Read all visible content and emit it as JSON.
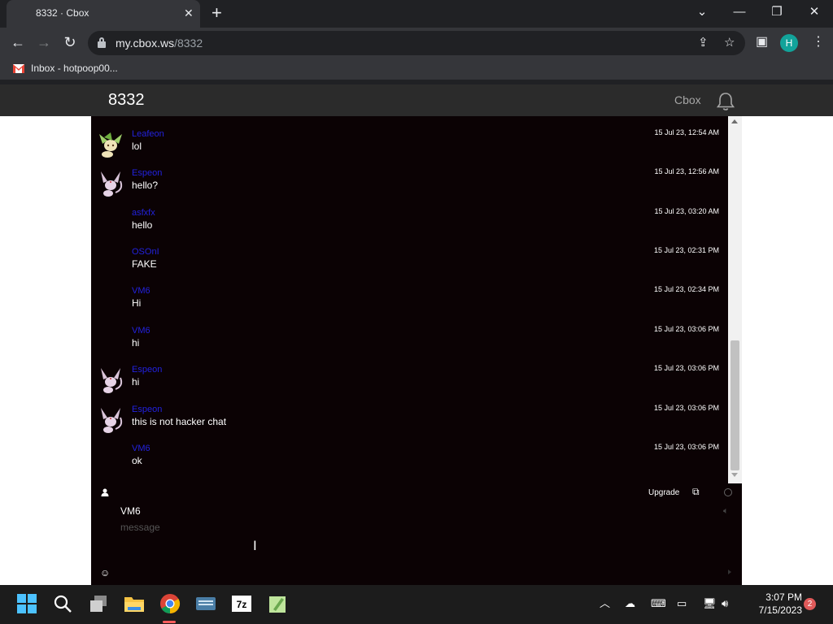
{
  "browser": {
    "tab_title": "8332 · Cbox",
    "tab_close": "✕",
    "new_tab": "+",
    "url_host": "my.cbox.ws",
    "url_path": "/8332",
    "bookmark_label": "Inbox - hotpoop00...",
    "avatar_letter": "H"
  },
  "site": {
    "title": "8332",
    "brand": "Cbox"
  },
  "messages": [
    {
      "name": "Leafeon",
      "text": "lol",
      "time": "15 Jul 23, 12:54 AM",
      "avatar": "leafeon-avatar"
    },
    {
      "name": "Espeon",
      "text": "hello?",
      "time": "15 Jul 23, 12:56 AM",
      "avatar": "espeon-avatar"
    },
    {
      "name": "asfxfx",
      "text": "hello",
      "time": "15 Jul 23, 03:20 AM",
      "avatar": ""
    },
    {
      "name": "OSOnI",
      "text": "FAKE",
      "time": "15 Jul 23, 02:31 PM",
      "avatar": ""
    },
    {
      "name": "VM6",
      "text": "Hi",
      "time": "15 Jul 23, 02:34 PM",
      "avatar": ""
    },
    {
      "name": "VM6",
      "text": "hi",
      "time": "15 Jul 23, 03:06 PM",
      "avatar": ""
    },
    {
      "name": "Espeon",
      "text": "hi",
      "time": "15 Jul 23, 03:06 PM",
      "avatar": "espeon-avatar"
    },
    {
      "name": "Espeon",
      "text": "this is not hacker chat",
      "time": "15 Jul 23, 03:06 PM",
      "avatar": "espeon-avatar"
    },
    {
      "name": "VM6",
      "text": "ok",
      "time": "15 Jul 23, 03:06 PM",
      "avatar": ""
    }
  ],
  "form": {
    "upgrade_label": "Upgrade",
    "name_value": "VM6",
    "message_placeholder": "message"
  },
  "taskbar": {
    "time": "3:07 PM",
    "date": "7/15/2023",
    "notification_count": "2"
  }
}
